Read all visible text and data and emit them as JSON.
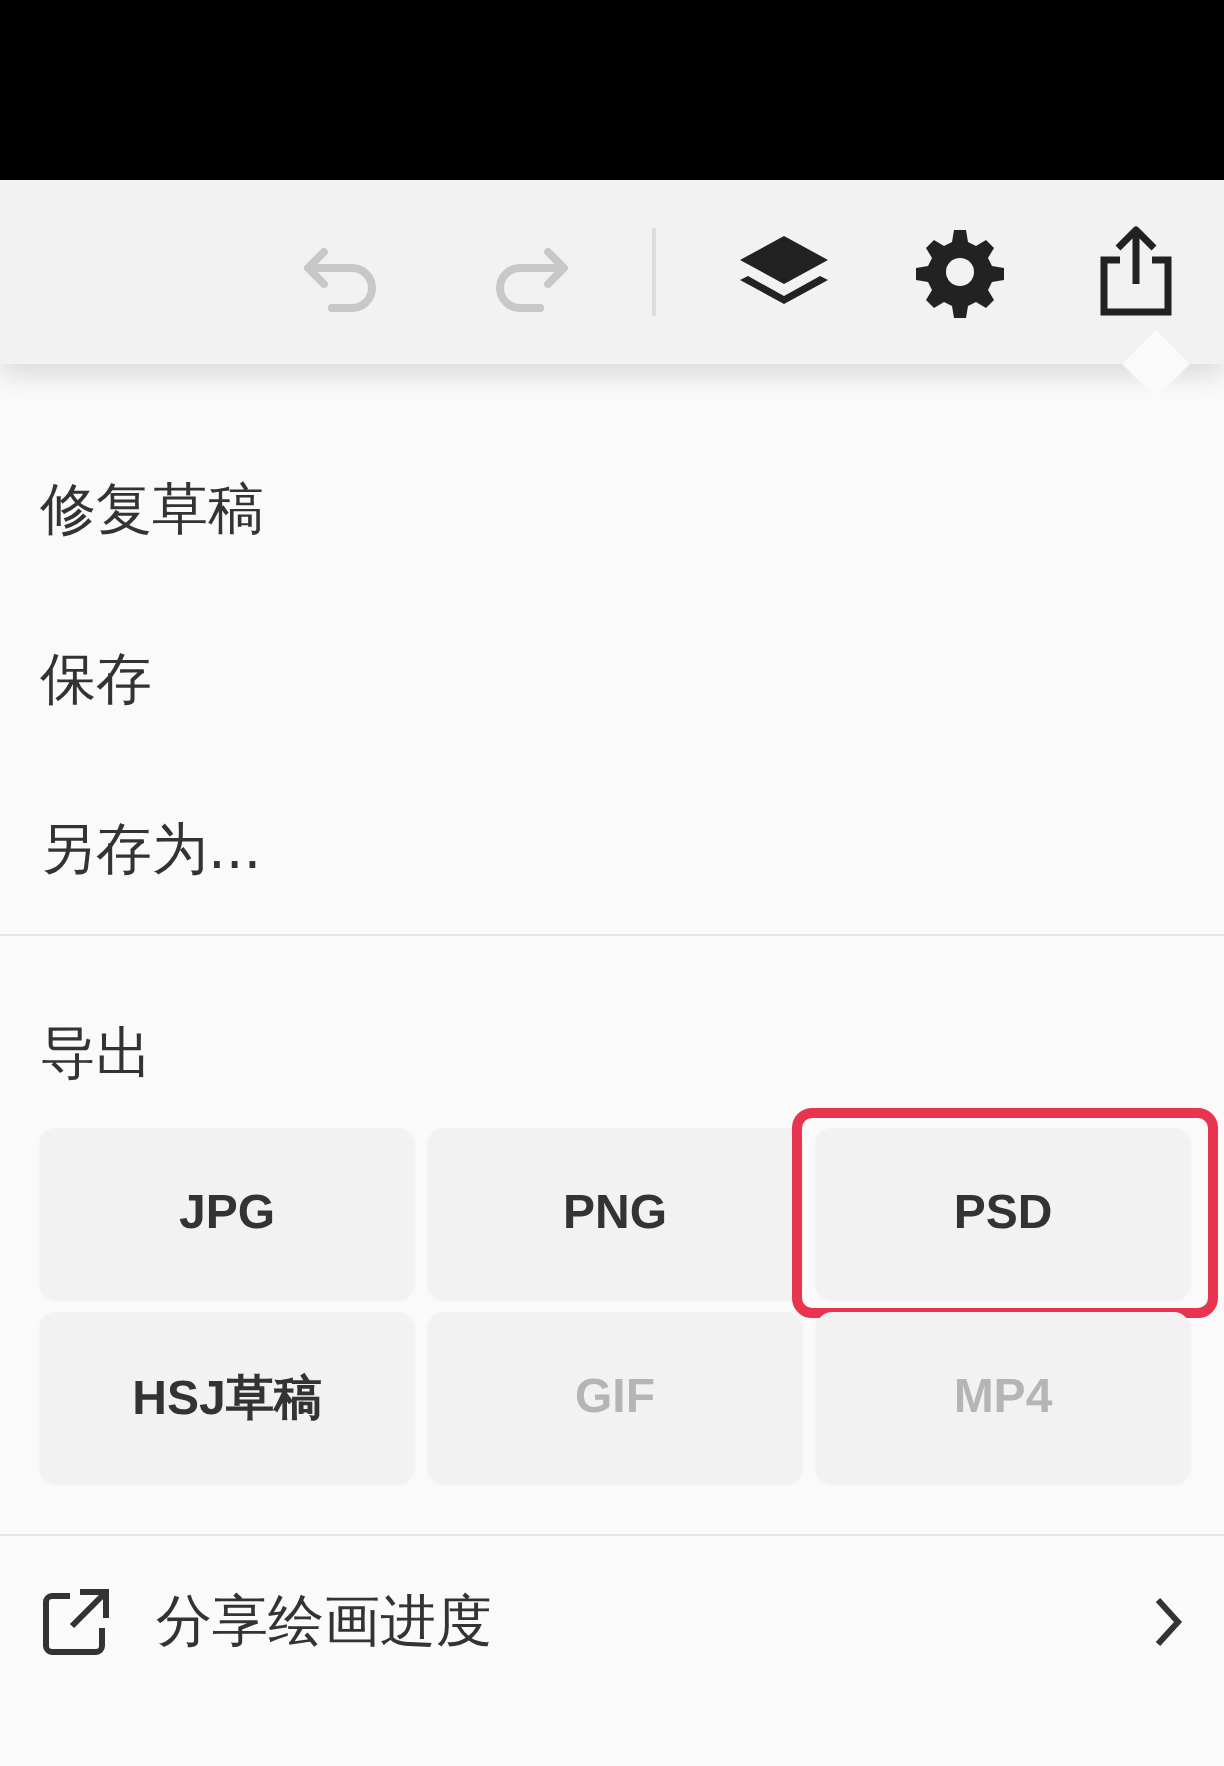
{
  "toolbar": {
    "tools": [
      {
        "kind": "undo",
        "disabled": true
      },
      {
        "kind": "redo",
        "disabled": true
      },
      {
        "kind": "divider"
      },
      {
        "kind": "layers",
        "disabled": false
      },
      {
        "kind": "settings",
        "disabled": false
      },
      {
        "kind": "share",
        "disabled": false
      }
    ]
  },
  "menu": {
    "items": [
      {
        "label": "修复草稿"
      },
      {
        "label": "保存"
      },
      {
        "label": "另存为..."
      }
    ]
  },
  "export": {
    "title": "导出",
    "formats": [
      {
        "label": "JPG",
        "disabled": false,
        "circled": false
      },
      {
        "label": "PNG",
        "disabled": false,
        "circled": false
      },
      {
        "label": "PSD",
        "disabled": false,
        "circled": true
      },
      {
        "label": "HSJ草稿",
        "disabled": false,
        "circled": false
      },
      {
        "label": "GIF",
        "disabled": true,
        "circled": false
      },
      {
        "label": "MP4",
        "disabled": true,
        "circled": false
      }
    ]
  },
  "share": {
    "label": "分享绘画进度"
  }
}
